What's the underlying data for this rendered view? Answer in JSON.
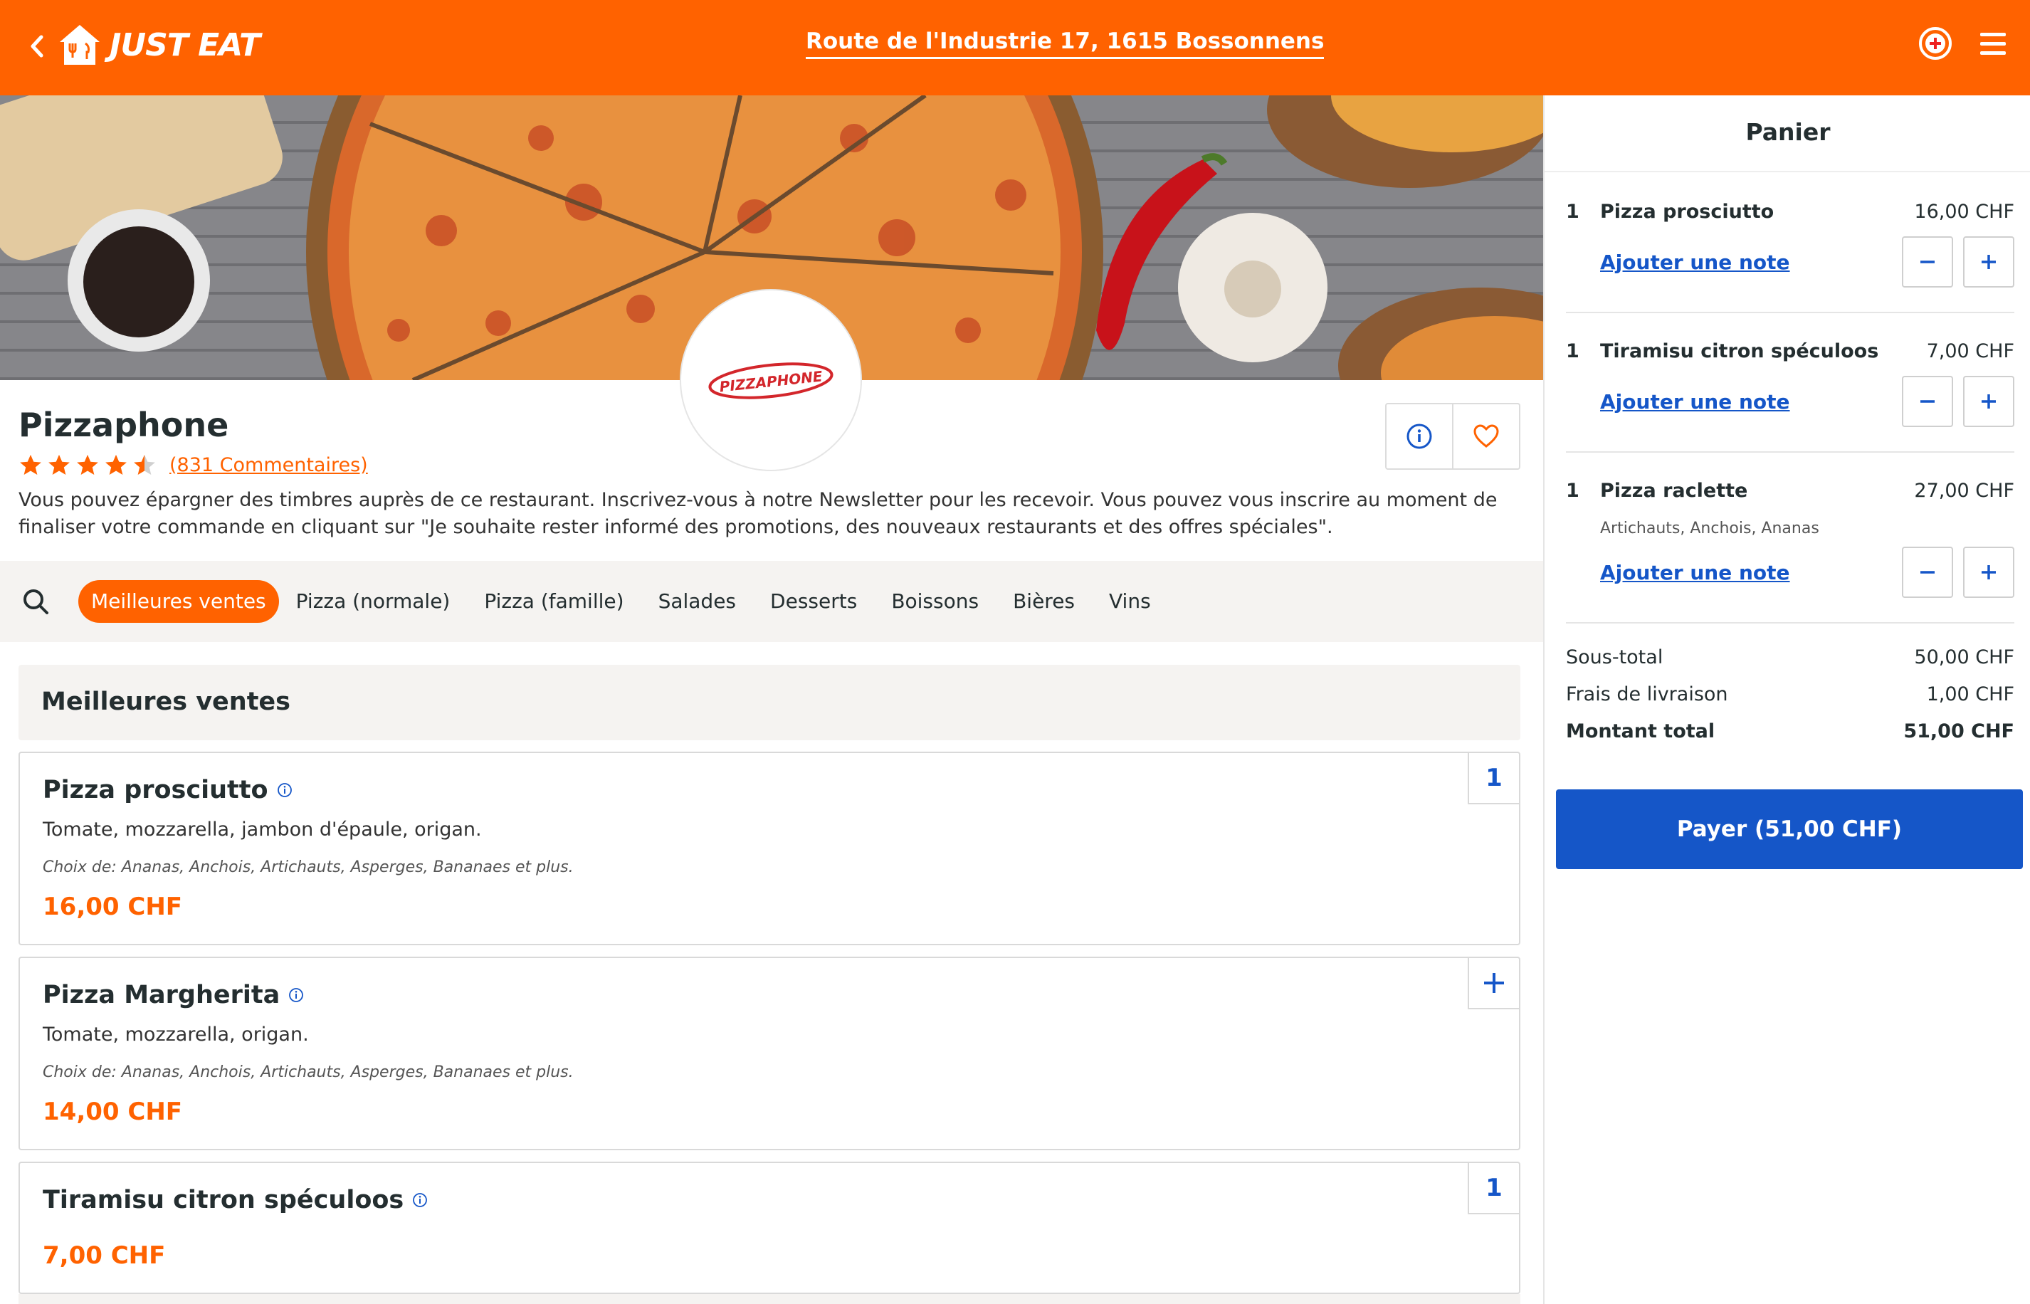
{
  "header": {
    "brand": "JUST EAT",
    "address": "Route de l'Industrie 17, 1615 Bossonnens",
    "color": "#ff6200"
  },
  "restaurant": {
    "logo_text": "PIZZAPHONE",
    "name": "Pizzaphone",
    "rating": 4.5,
    "reviews": "(831 Commentaires)",
    "description": "Vous pouvez épargner des timbres auprès de ce restaurant. Inscrivez-vous à notre Newsletter pour les recevoir. Vous pouvez vous inscrire au moment de finaliser votre commande en cliquant sur \"Je souhaite rester informé des promotions, des nouveaux restaurants et des offres spéciales\"."
  },
  "categories": [
    "Meilleures ventes",
    "Pizza (normale)",
    "Pizza (famille)",
    "Salades",
    "Desserts",
    "Boissons",
    "Bières",
    "Vins"
  ],
  "menu": {
    "section_title": "Meilleures ventes",
    "items": [
      {
        "title": "Pizza prosciutto",
        "desc": "Tomate, mozzarella, jambon d'épaule, origan.",
        "choice": "Choix de: Ananas, Anchois, Artichauts, Asperges, Bananaes et plus.",
        "price": "16,00 CHF",
        "qty": "1"
      },
      {
        "title": "Pizza Margherita",
        "desc": "Tomate, mozzarella, origan.",
        "choice": "Choix de: Ananas, Anchois, Artichauts, Asperges, Bananaes et plus.",
        "price": "14,00 CHF",
        "qty": "+"
      },
      {
        "title": "Tiramisu citron spéculoos",
        "price": "7,00 CHF",
        "qty": "1"
      }
    ]
  },
  "cart": {
    "title": "Panier",
    "note_label": "Ajouter une note",
    "items": [
      {
        "qty": "1",
        "name": "Pizza prosciutto",
        "price": "16,00 CHF"
      },
      {
        "qty": "1",
        "name": "Tiramisu citron spéculoos",
        "price": "7,00 CHF"
      },
      {
        "qty": "1",
        "name": "Pizza raclette",
        "price": "27,00 CHF",
        "options": "Artichauts, Anchois, Ananas"
      }
    ],
    "subtotal_label": "Sous-total",
    "subtotal": "50,00 CHF",
    "delivery_label": "Frais de livraison",
    "delivery": "1,00 CHF",
    "total_label": "Montant total",
    "total": "51,00 CHF",
    "pay_label": "Payer (51,00 CHF)",
    "pay_color": "#1556c8"
  }
}
